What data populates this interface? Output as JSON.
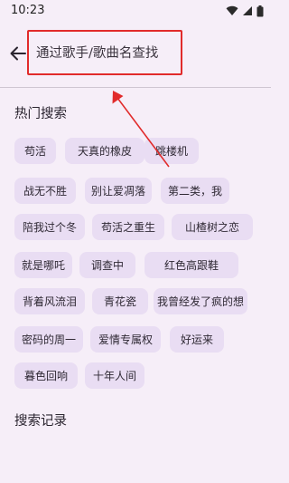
{
  "status_bar": {
    "time": "10:23"
  },
  "search": {
    "placeholder": "通过歌手/歌曲名查找"
  },
  "hot_search": {
    "title": "热门搜索",
    "items": [
      "苟活",
      "天真的橡皮",
      "跳楼机",
      "战无不胜",
      "别让爱凋落",
      "第二类，我",
      "陪我过个冬",
      "苟活之重生",
      "山楂树之恋",
      "就是哪吒",
      "调查中",
      "红色高跟鞋",
      "背着风流泪",
      "青花瓷",
      "我曾经发了疯的想",
      "密码的周一",
      "爱情专属权",
      "好运来",
      "暮色回响",
      "十年人间"
    ]
  },
  "history": {
    "title": "搜索记录"
  },
  "colors": {
    "background": "#f6eef8",
    "chip": "#e9ddf3",
    "annotation_red": "#e12b2b"
  }
}
